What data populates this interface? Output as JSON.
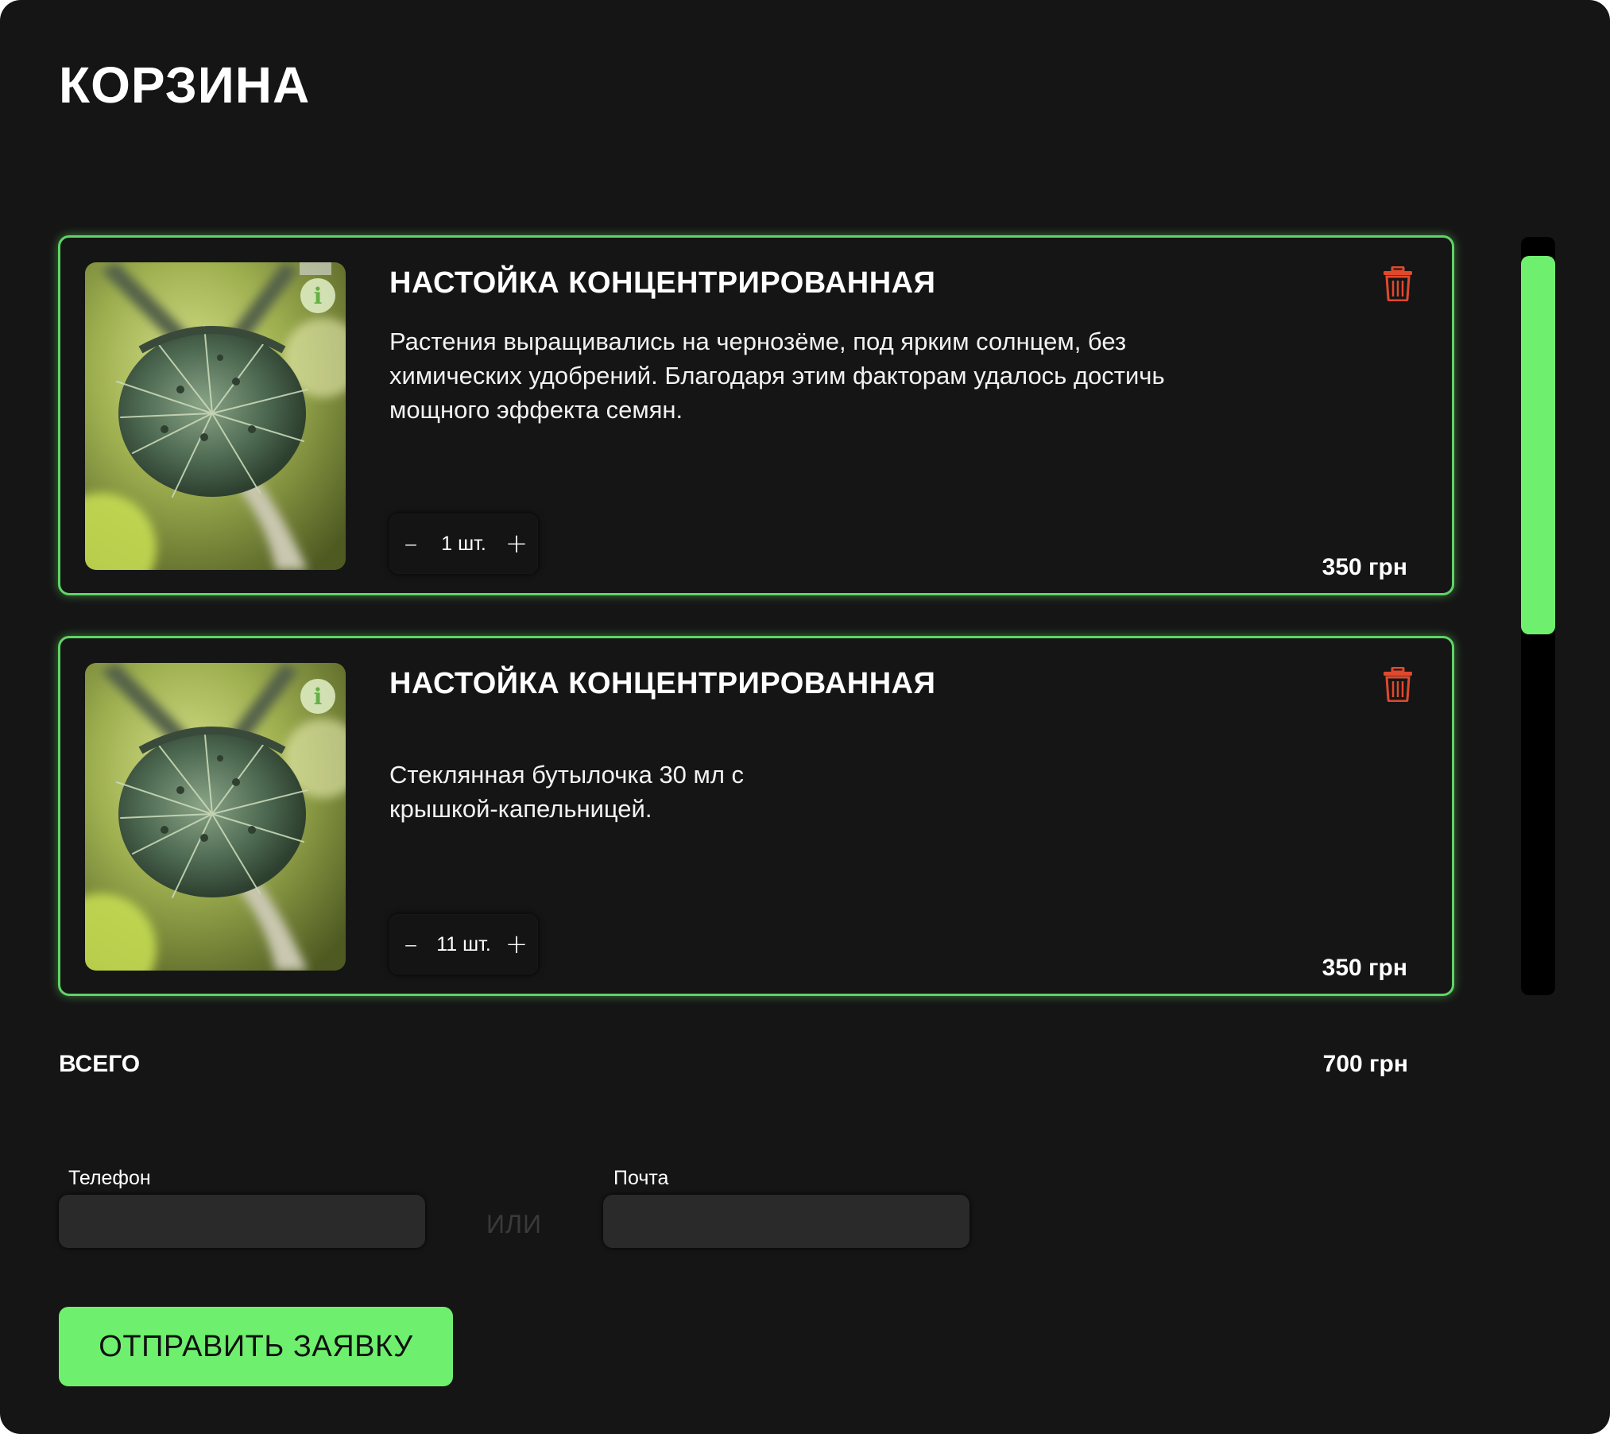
{
  "cart": {
    "title": "КОРЗИНА",
    "items": [
      {
        "title": "НАСТОЙКА КОНЦЕНТРИРОВАННАЯ",
        "description": "Растения выращивались на чернозёме, под ярким солнцем, без химических удобрений. Благодаря этим факторам удалось достичь мощного эффекта семян.",
        "quantity": "1 шт.",
        "price": "350 грн",
        "minus": "–",
        "plus": "+",
        "info_icon": "i"
      },
      {
        "title": "НАСТОЙКА КОНЦЕНТРИРОВАННАЯ",
        "description": "Стеклянная бутылочка 30 мл с крышкой-капельницей.",
        "quantity": "11 шт.",
        "price": "350 грн",
        "minus": "–",
        "plus": "+",
        "info_icon": "i"
      }
    ],
    "total_label": "ВСЕГО",
    "total_value": "700 грн"
  },
  "form": {
    "phone_label": "Телефон",
    "phone_value": "",
    "or_text": "ИЛИ",
    "email_label": "Почта",
    "email_value": "",
    "submit_label": "ОТПРАВИТЬ ЗАЯВКУ"
  },
  "icons": {
    "delete": "trash-icon",
    "info": "info-icon"
  },
  "colors": {
    "background": "#151515",
    "accent": "#6ef06e",
    "delete": "#e0492c",
    "field": "#2a2a2a"
  }
}
